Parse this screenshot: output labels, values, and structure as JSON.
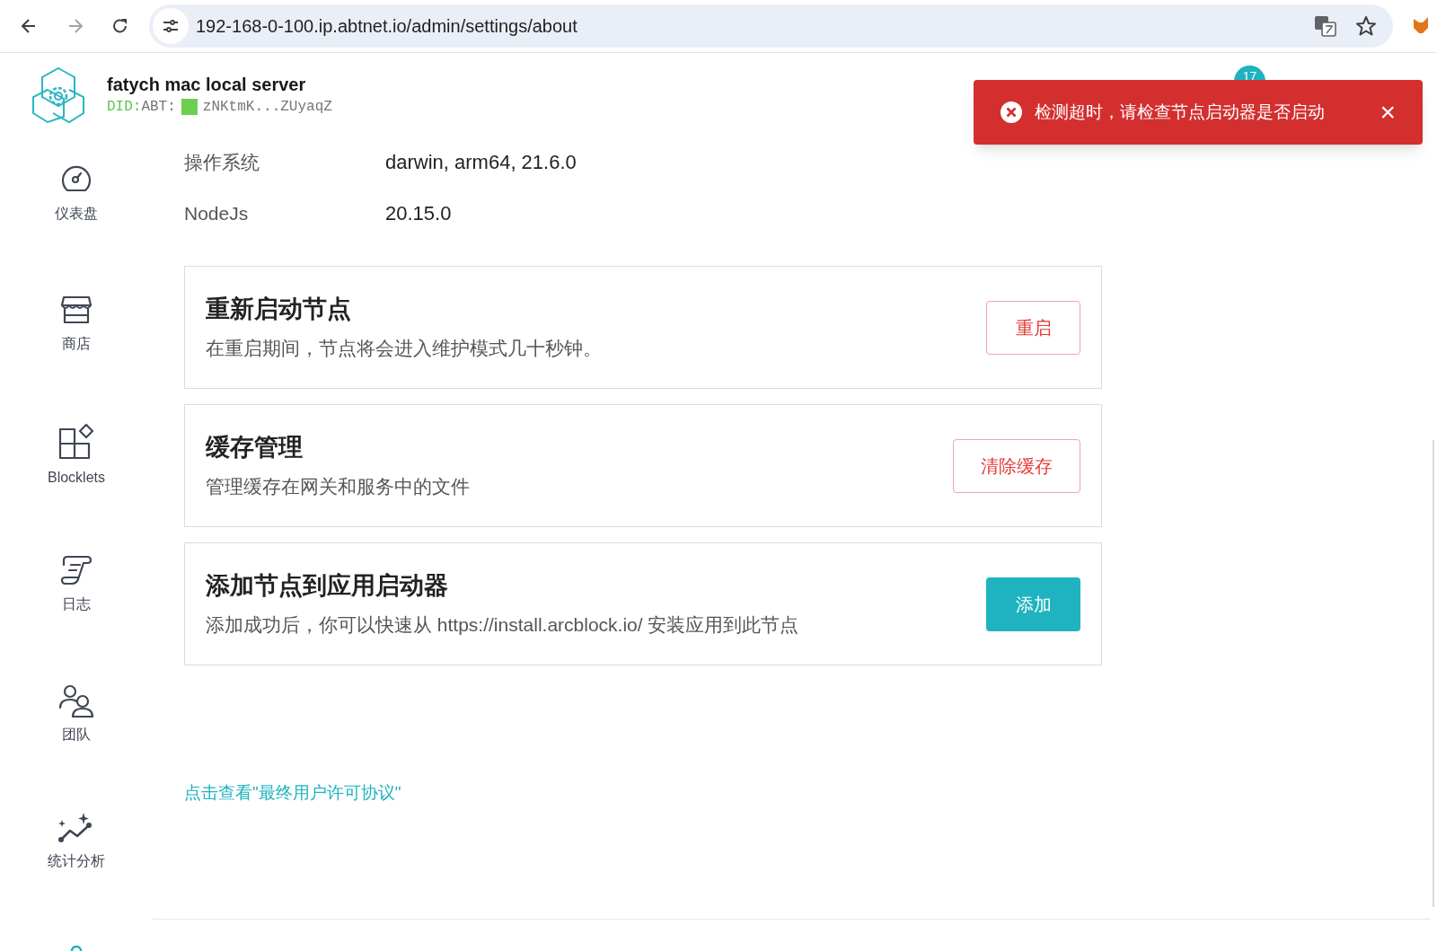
{
  "browser": {
    "url": "192-168-0-100.ip.abtnet.io/admin/settings/about"
  },
  "header": {
    "title": "fatych mac local server",
    "did_prefix": "DID:",
    "did_type": "ABT:",
    "did_value": "zNKtmK...ZUyaqZ",
    "badge": "17"
  },
  "toast": {
    "message": "检测超时，请检查节点启动器是否启动",
    "close": "×"
  },
  "sidebar": {
    "items": [
      {
        "label": "仪表盘"
      },
      {
        "label": "商店"
      },
      {
        "label": "Blocklets"
      },
      {
        "label": "日志"
      },
      {
        "label": "团队"
      },
      {
        "label": "统计分析"
      }
    ]
  },
  "info": [
    {
      "label": "操作系统",
      "value": "darwin, arm64, 21.6.0"
    },
    {
      "label": "NodeJs",
      "value": "20.15.0"
    }
  ],
  "cards": [
    {
      "title": "重新启动节点",
      "description": "在重启期间，节点将会进入维护模式几十秒钟。",
      "button": {
        "label": "重启",
        "kind": "outline"
      }
    },
    {
      "title": "缓存管理",
      "description": "管理缓存在网关和服务中的文件",
      "button": {
        "label": "清除缓存",
        "kind": "outline"
      }
    },
    {
      "title": "添加节点到应用启动器",
      "description": "添加成功后，你可以快速从 https://install.arcblock.io/ 安装应用到此节点",
      "button": {
        "label": "添加",
        "kind": "filled"
      }
    }
  ],
  "eula_link": "点击查看\"最终用户许可协议\""
}
